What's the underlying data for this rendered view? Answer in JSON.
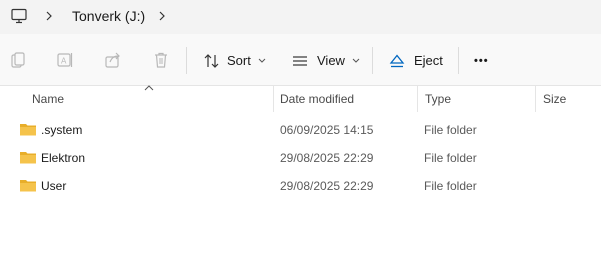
{
  "address": {
    "crumbs": [
      "Tonverk (J:)"
    ],
    "root_icon": "this-pc-icon"
  },
  "toolbar": {
    "icon_buttons": [
      "copy-icon",
      "rename-icon",
      "share-icon",
      "delete-icon"
    ],
    "sort_label": "Sort",
    "view_label": "View",
    "eject_label": "Eject",
    "more_label": "•••"
  },
  "columns": {
    "name": "Name",
    "date": "Date modified",
    "type": "Type",
    "size": "Size"
  },
  "files": [
    {
      "name": ".system",
      "date": "06/09/2025 14:15",
      "type": "File folder",
      "size": ""
    },
    {
      "name": "Elektron",
      "date": "29/08/2025 22:29",
      "type": "File folder",
      "size": ""
    },
    {
      "name": "User",
      "date": "29/08/2025 22:29",
      "type": "File folder",
      "size": ""
    }
  ],
  "colors": {
    "folder": "#f5c34b",
    "accent": "#0067c0"
  }
}
